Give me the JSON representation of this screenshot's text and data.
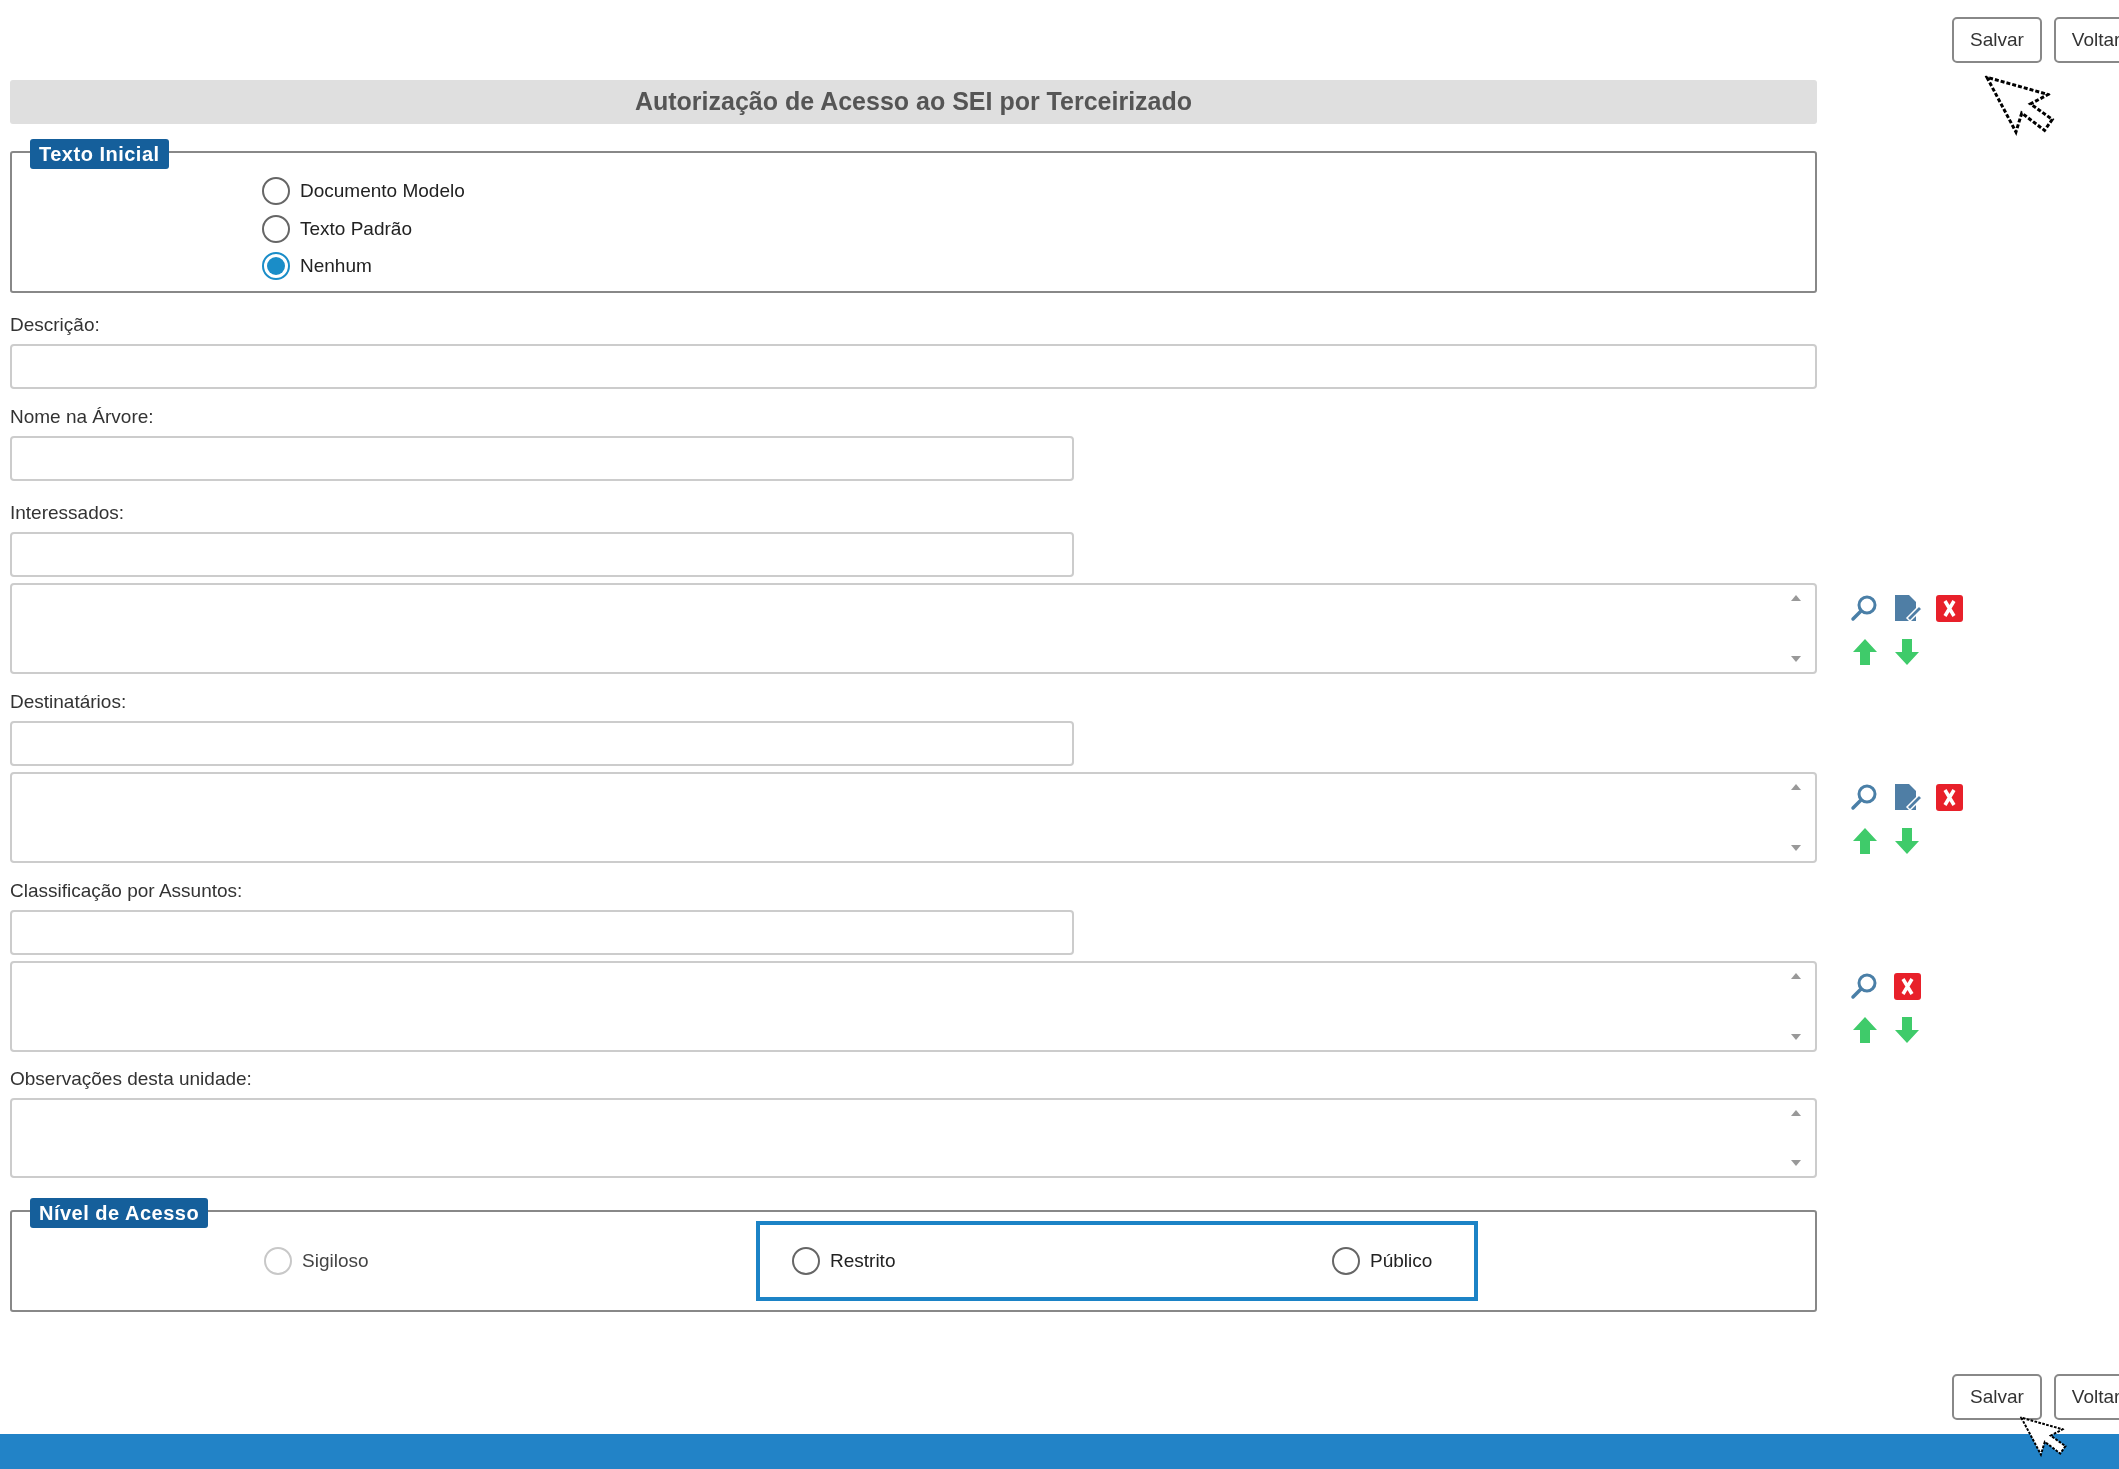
{
  "top_buttons": [
    {
      "label": "Salvar"
    },
    {
      "label": "Voltar"
    }
  ],
  "title": "Autorização de Acesso ao SEI por Terceirizado",
  "texto_inicial": {
    "legend": "Texto Inicial",
    "options": [
      {
        "label": "Documento Modelo",
        "selected": false
      },
      {
        "label": "Texto Padrão",
        "selected": false
      },
      {
        "label": "Nenhum",
        "selected": true
      }
    ]
  },
  "fields": [
    {
      "kind": "wide_text",
      "label": "Descrição:"
    },
    {
      "kind": "text",
      "label": "Nome na Árvore:"
    },
    {
      "kind": "lookup",
      "label": "Interessados:",
      "editable": true
    },
    {
      "kind": "lookup",
      "label": "Destinatários:",
      "editable": true
    },
    {
      "kind": "lookup",
      "label": "Classificação por Assuntos:",
      "editable": false
    },
    {
      "kind": "notes",
      "label": "Observações desta unidade:"
    }
  ],
  "nivel_acesso": {
    "legend": "Nível de Acesso",
    "options": [
      {
        "label": "Sigiloso",
        "selected": false,
        "disabled": true,
        "highlighted": false
      },
      {
        "label": "Restrito",
        "selected": false,
        "disabled": false,
        "highlighted": true
      },
      {
        "label": "Público",
        "selected": false,
        "disabled": false,
        "highlighted": true
      }
    ]
  },
  "bottom_buttons": [
    {
      "label": "Salvar"
    },
    {
      "label": "Voltar"
    }
  ]
}
